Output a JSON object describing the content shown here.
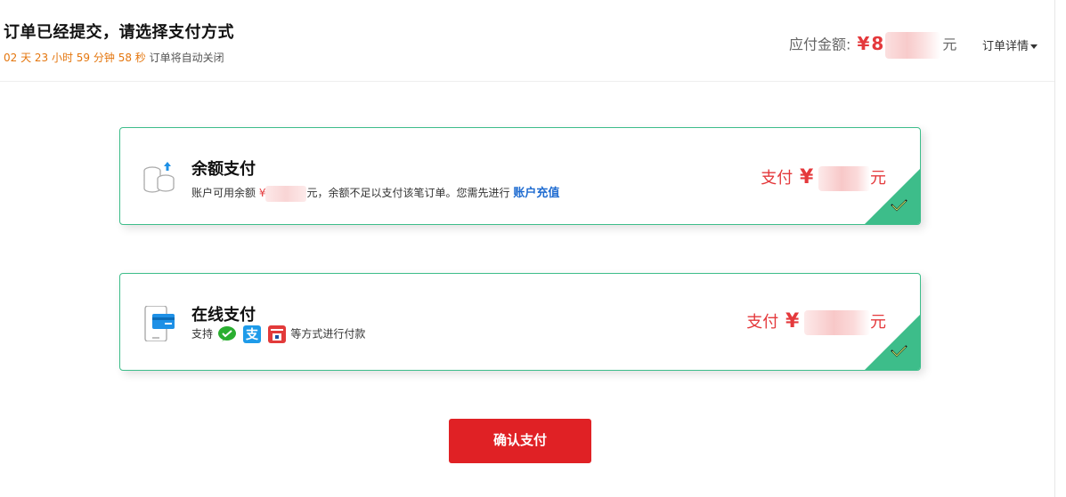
{
  "header": {
    "title": "订单已经提交，请选择支付方式",
    "countdown_timer": "02 天 23 小时 59 分钟 58 秒",
    "countdown_suffix": "订单将自动关闭",
    "amount_label": "应付金额:",
    "currency_symbol": "¥",
    "amount_partial": "8",
    "amount_unit": "元",
    "detail_link": "订单详情"
  },
  "methods": [
    {
      "name": "余额支付",
      "desc_prefix": "账户可用余额",
      "currency_symbol": "¥",
      "desc_middle": "元，余额不足以支付该笔订单。您需先进行",
      "recharge_link": "账户充值",
      "pay_label": "支付",
      "pay_currency": "¥",
      "pay_unit": "元",
      "icon": "coins-icon"
    },
    {
      "name": "在线支付",
      "desc_prefix": "支持",
      "desc_suffix": "等方式进行付款",
      "pay_label": "支付",
      "pay_currency": "¥",
      "pay_unit": "元",
      "icon": "mobile-card-icon",
      "providers": [
        "wechat-pay-icon",
        "alipay-icon",
        "unionpay-icon"
      ]
    }
  ],
  "confirm_button": "确认支付",
  "colors": {
    "accent_red": "#e02125",
    "price_red": "#e4393c",
    "selected_green": "#3dbd8a",
    "timer_orange": "#e4760e",
    "link_blue": "#1f6cd1"
  }
}
